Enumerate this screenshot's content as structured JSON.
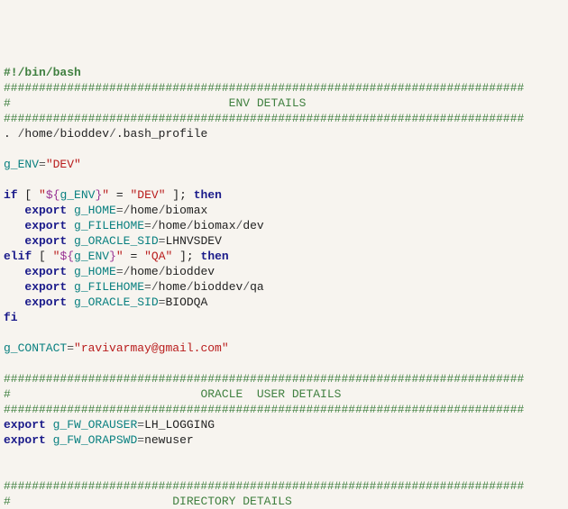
{
  "l1_shebang": "#!/bin/bash",
  "l2_hashline": "##########################################################################",
  "l3_a": "#                               ",
  "l3_b": "ENV DETAILS",
  "l4_hashline": "##########################################################################",
  "l5_a": ". ",
  "l5_b": "/",
  "l5_c": "home",
  "l5_d": "bioddev",
  "l5_e": ".bash_profile",
  "l7_a": "g_ENV",
  "l7_b": "=",
  "l7_c": "\"DEV\"",
  "l9_if": "if",
  "l9_a": " [ ",
  "l9_b": "\"",
  "l9_c": "${",
  "l9_d": "g_ENV",
  "l9_e": "}",
  "l9_f": "\"",
  "l9_g": " = ",
  "l9_h": "\"DEV\"",
  "l9_i": " ]; ",
  "l9_then": "then",
  "l10_a": "   ",
  "l10_export": "export",
  "l10_b": " ",
  "l10_var": "g_HOME",
  "l10_c": "=",
  "l10_d": "/",
  "l10_e": "home",
  "l10_f": "biomax",
  "l11_a": "   ",
  "l11_export": "export",
  "l11_b": " ",
  "l11_var": "g_FILEHOME",
  "l11_c": "=",
  "l11_d": "/",
  "l11_e": "home",
  "l11_f": "biomax",
  "l11_g": "dev",
  "l12_a": "   ",
  "l12_export": "export",
  "l12_b": " ",
  "l12_var": "g_ORACLE_SID",
  "l12_c": "=",
  "l12_d": "LHNVSDEV",
  "l13_elif": "elif",
  "l13_a": " [ ",
  "l13_b": "\"",
  "l13_c": "${",
  "l13_d": "g_ENV",
  "l13_e": "}",
  "l13_f": "\"",
  "l13_g": " = ",
  "l13_h": "\"QA\"",
  "l13_i": " ]; ",
  "l13_then": "then",
  "l14_a": "   ",
  "l14_export": "export",
  "l14_b": " ",
  "l14_var": "g_HOME",
  "l14_c": "=",
  "l14_d": "/",
  "l14_e": "home",
  "l14_f": "bioddev",
  "l15_a": "   ",
  "l15_export": "export",
  "l15_b": " ",
  "l15_var": "g_FILEHOME",
  "l15_c": "=",
  "l15_d": "/",
  "l15_e": "home",
  "l15_f": "bioddev",
  "l15_g": "qa",
  "l16_a": "   ",
  "l16_export": "export",
  "l16_b": " ",
  "l16_var": "g_ORACLE_SID",
  "l16_c": "=",
  "l16_d": "BIODQA",
  "l17_fi": "fi",
  "l19_a": "g_CONTACT",
  "l19_b": "=",
  "l19_c": "\"ravivarmay@gmail.com\"",
  "l21_hashline": "##########################################################################",
  "l22_a": "#                           ",
  "l22_b": "ORACLE  USER DETAILS",
  "l23_hashline": "##########################################################################",
  "l24_export": "export",
  "l24_a": " ",
  "l24_var": "g_FW_ORAUSER",
  "l24_b": "=",
  "l24_c": "LH_LOGGING",
  "l25_export": "export",
  "l25_a": " ",
  "l25_var": "g_FW_ORAPSWD",
  "l25_b": "=",
  "l25_c": "newuser",
  "l28_hashline": "##########################################################################",
  "l29_a": "#                       ",
  "l29_b": "DIRECTORY DETAILS"
}
